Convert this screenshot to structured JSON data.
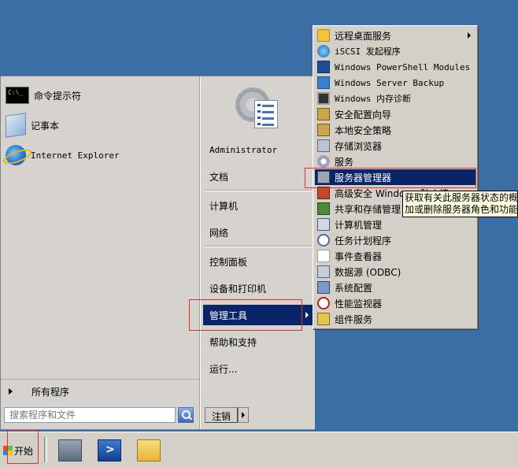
{
  "start_menu": {
    "pinned": [
      {
        "label": "命令提示符",
        "icon": "command-prompt-icon"
      },
      {
        "label": "记事本",
        "icon": "notepad-icon"
      },
      {
        "label": "Internet Explorer",
        "icon": "internet-explorer-icon"
      }
    ],
    "all_programs": "所有程序",
    "search_placeholder": "搜索程序和文件",
    "user_name": "Administrator",
    "right_items": {
      "documents": "文档",
      "computer": "计算机",
      "network": "网络",
      "control_panel": "控制面板",
      "devices_printers": "设备和打印机",
      "admin_tools": "管理工具",
      "help": "帮助和支持",
      "run": "运行..."
    },
    "shutdown_label": "注销"
  },
  "admin_tools_menu": {
    "items": [
      {
        "label": "远程桌面服务",
        "icon": "folder-icon"
      },
      {
        "label": "iSCSI 发起程序",
        "icon": "globe-icon"
      },
      {
        "label": "Windows PowerShell Modules",
        "icon": "powershell-icon"
      },
      {
        "label": "Windows Server Backup",
        "icon": "backup-icon"
      },
      {
        "label": "Windows 内存诊断",
        "icon": "memory-diagnostic-icon"
      },
      {
        "label": "安全配置向导",
        "icon": "security-wizard-icon"
      },
      {
        "label": "本地安全策略",
        "icon": "local-policy-icon"
      },
      {
        "label": "存储浏览器",
        "icon": "storage-explorer-icon"
      },
      {
        "label": "服务",
        "icon": "services-icon"
      },
      {
        "label": "服务器管理器",
        "icon": "server-manager-icon"
      },
      {
        "label": "高级安全 Windows 防火墙",
        "icon": "firewall-icon"
      },
      {
        "label": "共享和存储管理",
        "icon": "share-storage-icon"
      },
      {
        "label": "计算机管理",
        "icon": "computer-management-icon"
      },
      {
        "label": "任务计划程序",
        "icon": "task-scheduler-icon"
      },
      {
        "label": "事件查看器",
        "icon": "event-viewer-icon"
      },
      {
        "label": "数据源 (ODBC)",
        "icon": "odbc-icon"
      },
      {
        "label": "系统配置",
        "icon": "system-config-icon"
      },
      {
        "label": "性能监视器",
        "icon": "performance-monitor-icon"
      },
      {
        "label": "组件服务",
        "icon": "component-services-icon"
      }
    ],
    "tooltip": {
      "line1": "获取有关此服务器状态的概",
      "line2": "加或删除服务器角色和功能"
    }
  },
  "taskbar": {
    "start_label": "开始",
    "icons": [
      "server-manager-taskbar-icon",
      "powershell-taskbar-icon",
      "explorer-taskbar-icon"
    ]
  },
  "colors": {
    "desktop": "#3a6ea5",
    "highlight": "#0a246a",
    "annotation": "#e03030"
  }
}
